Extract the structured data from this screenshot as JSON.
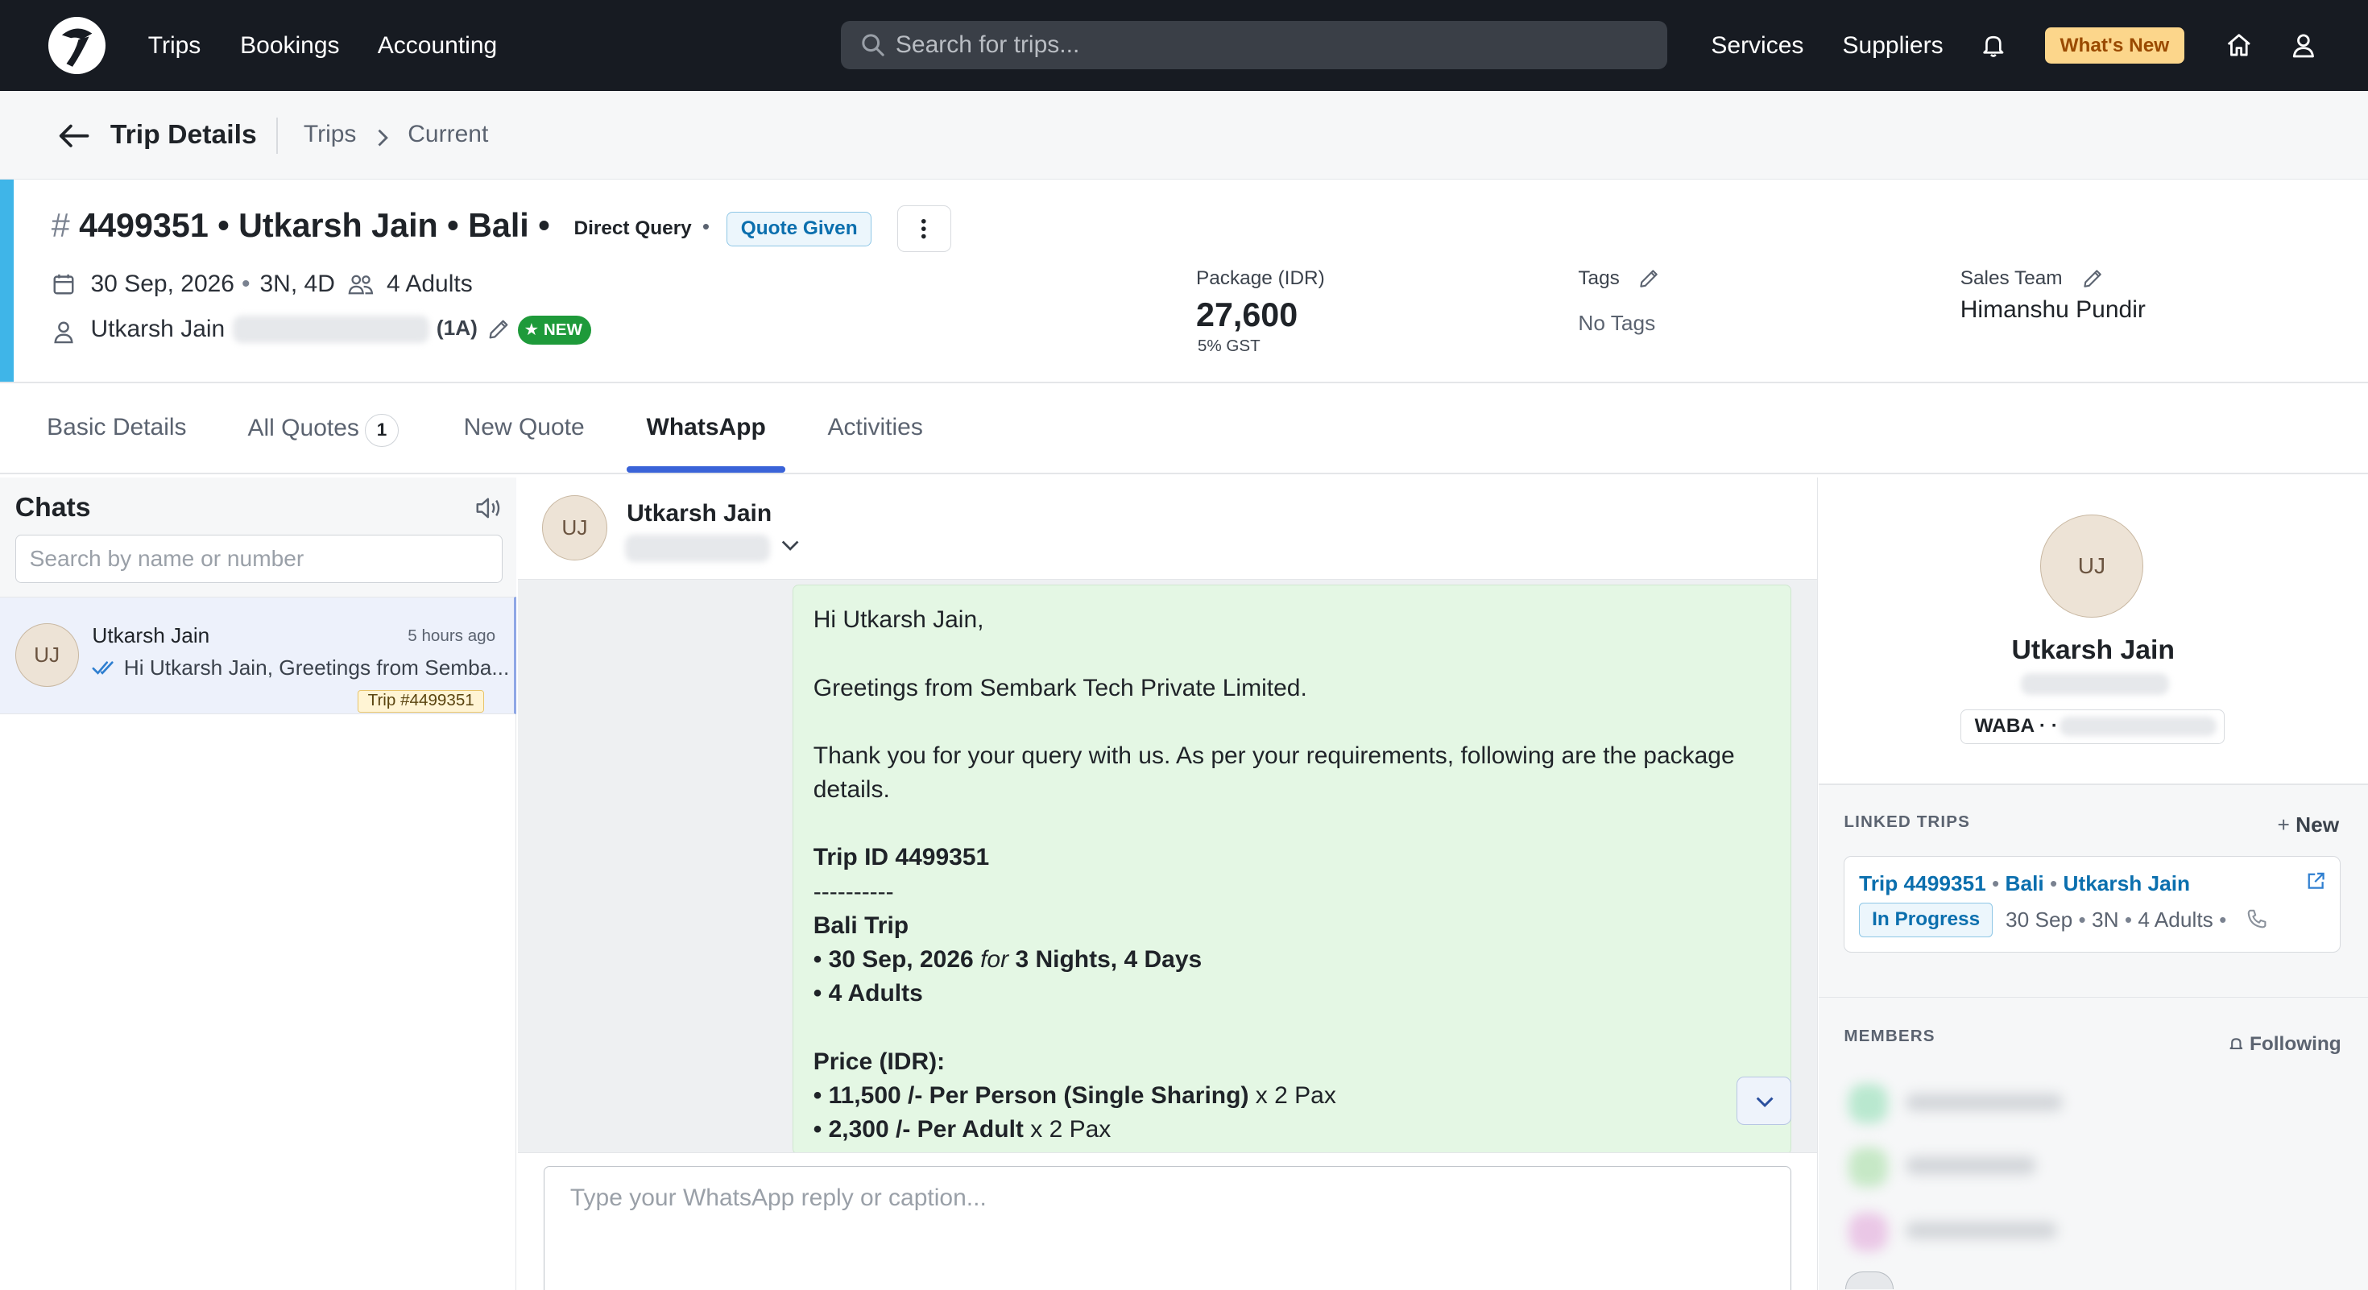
{
  "nav": {
    "links": [
      "Trips",
      "Bookings",
      "Accounting"
    ],
    "search_placeholder": "Search for trips...",
    "right_links": [
      "Services",
      "Suppliers"
    ],
    "whats_new": "What's New"
  },
  "breadcrumb": {
    "title": "Trip Details",
    "trail": [
      "Trips",
      "Current"
    ]
  },
  "trip": {
    "hash": "#",
    "title": "4499351 • Utkarsh Jain • Bali •",
    "source": "Direct Query",
    "separator": "•",
    "status": "Quote Given",
    "date": "30 Sep, 2026",
    "duration": "3N, 4D",
    "travellers": "4 Adults",
    "customer": "Utkarsh Jain",
    "customer_tag": "(1A)",
    "new_badge": "NEW",
    "package_label": "Package (IDR)",
    "package_value": "27,600",
    "gst": "5% GST",
    "tags_label": "Tags",
    "tags_value": "No Tags",
    "sales_label": "Sales Team",
    "sales_value": "Himanshu Pundir"
  },
  "tabs": {
    "basic": "Basic Details",
    "quotes": "All Quotes",
    "quotes_count": "1",
    "new_quote": "New Quote",
    "whatsapp": "WhatsApp",
    "activities": "Activities"
  },
  "chats": {
    "title": "Chats",
    "search_placeholder": "Search by name or number",
    "items": [
      {
        "initials": "UJ",
        "name": "Utkarsh Jain",
        "time": "5 hours ago",
        "preview": "Hi Utkarsh Jain, Greetings from Semba...",
        "trip_chip": "Trip #4499351"
      }
    ]
  },
  "conversation": {
    "initials": "UJ",
    "name": "Utkarsh Jain",
    "message": {
      "greeting": "Hi Utkarsh Jain,",
      "line2": "Greetings from Sembark Tech Private Limited.",
      "line3": "Thank you for your query with us. As per your requirements, following are the package details.",
      "trip_id": "Trip ID 4499351",
      "rule": "----------",
      "trip_name": "Bali Trip",
      "date_bullet": "• 30 Sep, 2026",
      "for_word": "for",
      "nights": "3 Nights, 4 Days",
      "adults": "• 4 Adults",
      "price_head": "Price (IDR):",
      "price1": "• 11,500 /- Per Person (Single Sharing)",
      "price1_qty": "x 2 Pax",
      "price2": "• 2,300 /- Per Adult",
      "price2_qty": "x 2 Pax"
    },
    "composer_placeholder": "Type your WhatsApp reply or caption..."
  },
  "contact": {
    "initials": "UJ",
    "name": "Utkarsh Jain",
    "waba": "WABA · ·",
    "linked_trips_label": "LINKED TRIPS",
    "new_link": "New",
    "linked_trip": {
      "id": "Trip 4499351",
      "destination": "Bali",
      "customer": "Utkarsh Jain",
      "status": "In Progress",
      "date": "30 Sep",
      "nights": "3N",
      "pax": "4 Adults"
    },
    "members_label": "MEMBERS",
    "following": "Following"
  },
  "colors": {
    "nav_bg": "#171b22",
    "accent_blue": "#3a63d8",
    "trip_accent": "#3fb5e8",
    "bubble_green": "#e4f7e4",
    "new_badge_green": "#1e9a3a",
    "whats_new_bg": "#fcd68b"
  }
}
